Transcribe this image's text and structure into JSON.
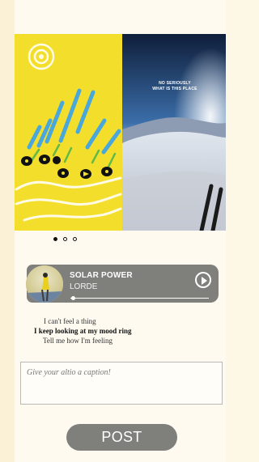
{
  "media": {
    "overlay_text": [
      "NO SERIOUSLY",
      "WHAT IS THIS PLACE"
    ],
    "page_count": 3,
    "active_page": 0
  },
  "music": {
    "title": "SOLAR POWER",
    "artist": "LORDE",
    "progress": 0.02
  },
  "lyrics": [
    "I can't feel a thing",
    "I keep looking at my mood ring",
    "Tell me how I'm feeling"
  ],
  "caption": {
    "placeholder": "Give your altio a caption!"
  },
  "post_button": {
    "label": "POST"
  },
  "colors": {
    "background": "#fdf7e6",
    "art_yellow": "#f3df2b",
    "player_gray": "#7f7f7c"
  }
}
